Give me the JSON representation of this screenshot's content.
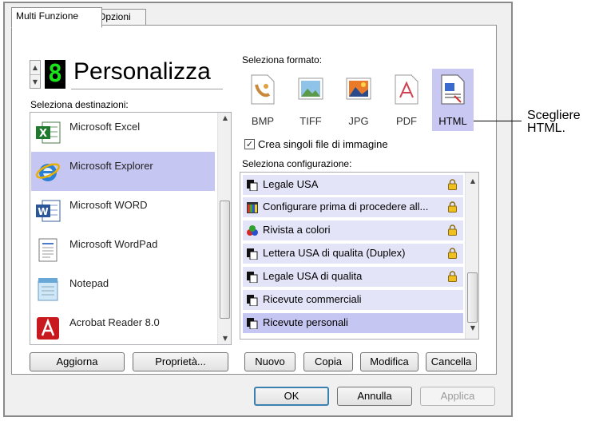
{
  "tabs": [
    {
      "label": "Multi Funzione"
    },
    {
      "label": "Opzioni"
    }
  ],
  "profile": {
    "digit": "8",
    "name": "Personalizza"
  },
  "destinations": {
    "label": "Seleziona destinazioni:",
    "items": [
      {
        "label": "Microsoft Excel",
        "icon": "excel-icon"
      },
      {
        "label": "Microsoft Explorer",
        "icon": "internet-explorer-icon",
        "selected": true
      },
      {
        "label": "Microsoft WORD",
        "icon": "word-icon"
      },
      {
        "label": "Microsoft WordPad",
        "icon": "wordpad-icon"
      },
      {
        "label": "Notepad",
        "icon": "notepad-icon"
      },
      {
        "label": "Acrobat Reader 8.0",
        "icon": "acrobat-icon"
      }
    ]
  },
  "formats": {
    "label": "Seleziona formato:",
    "items": [
      {
        "label": "BMP",
        "icon": "bmp-icon"
      },
      {
        "label": "TIFF",
        "icon": "tiff-icon"
      },
      {
        "label": "JPG",
        "icon": "jpg-icon"
      },
      {
        "label": "PDF",
        "icon": "pdf-icon"
      },
      {
        "label": "HTML",
        "icon": "html-icon",
        "selected": true
      }
    ]
  },
  "single_files": {
    "label": "Crea singoli file di immagine",
    "checked": true
  },
  "configurations": {
    "label": "Seleziona configurazione:",
    "items": [
      {
        "label": "Legale USA",
        "locked": true
      },
      {
        "label": "Configurare prima di procedere all...",
        "locked": true
      },
      {
        "label": "Rivista a colori",
        "locked": true
      },
      {
        "label": "Lettera USA di qualita (Duplex)",
        "locked": true
      },
      {
        "label": "Legale USA di qualita",
        "locked": true
      },
      {
        "label": "Ricevute commerciali",
        "locked": false
      },
      {
        "label": "Ricevute personali",
        "locked": false,
        "selected": true
      }
    ]
  },
  "buttons": {
    "update": "Aggiorna",
    "properties": "Proprietà...",
    "new": "Nuovo",
    "copy": "Copia",
    "edit": "Modifica",
    "delete": "Cancella",
    "ok": "OK",
    "cancel": "Annulla",
    "apply": "Applica"
  },
  "callout": {
    "line1": "Scegliere",
    "line2": "HTML."
  }
}
